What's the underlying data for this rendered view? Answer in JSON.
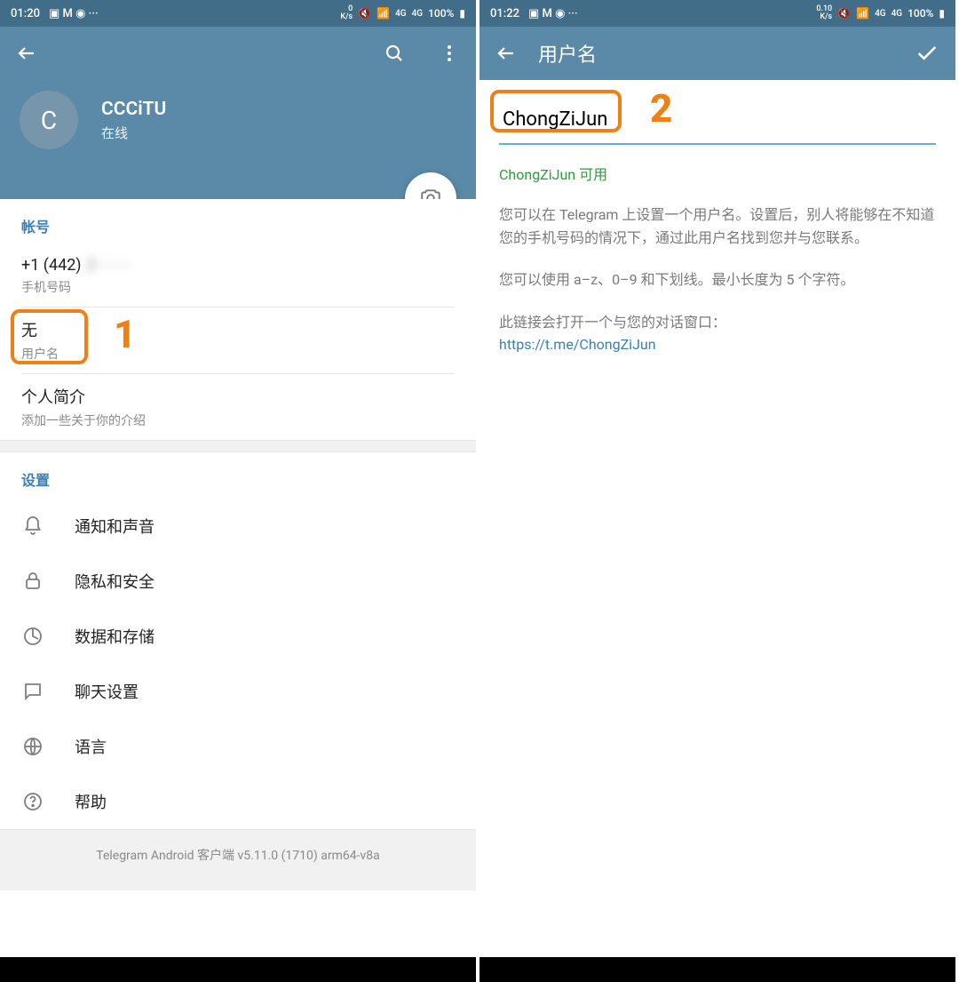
{
  "left": {
    "status": {
      "time": "01:20",
      "net_rate": "0\nK/s",
      "battery": "100%"
    },
    "profile": {
      "avatar_letter": "C",
      "name": "CCCiTU",
      "status": "在线"
    },
    "section_account": "帐号",
    "phone": {
      "value": "+1 (442)",
      "hidden_partial": "2·······",
      "label": "手机号码"
    },
    "username": {
      "value": "无",
      "label": "用户名"
    },
    "bio": {
      "value": "个人简介",
      "label": "添加一些关于你的介绍"
    },
    "section_settings": "设置",
    "settings": [
      {
        "label": "通知和声音"
      },
      {
        "label": "隐私和安全"
      },
      {
        "label": "数据和存储"
      },
      {
        "label": "聊天设置"
      },
      {
        "label": "语言"
      },
      {
        "label": "帮助"
      }
    ],
    "footer": "Telegram Android 客户端 v5.11.0 (1710) arm64-v8a",
    "annotation_number": "1"
  },
  "right": {
    "status": {
      "time": "01:22",
      "net_rate": "0.10\nK/s",
      "battery": "100%"
    },
    "toolbar_title": "用户名",
    "input_value": "ChongZiJun",
    "available_text": "ChongZiJun 可用",
    "info_p1": "您可以在 Telegram 上设置一个用户名。设置后，别人将能够在不知道您的手机号码的情况下，通过此用户名找到您并与您联系。",
    "info_p2": "您可以使用 a–z、0–9 和下划线。最小长度为 5 个字符。",
    "info_p3": "此链接会打开一个与您的对话窗口：",
    "link": "https://t.me/ChongZiJun",
    "annotation_number": "2"
  }
}
